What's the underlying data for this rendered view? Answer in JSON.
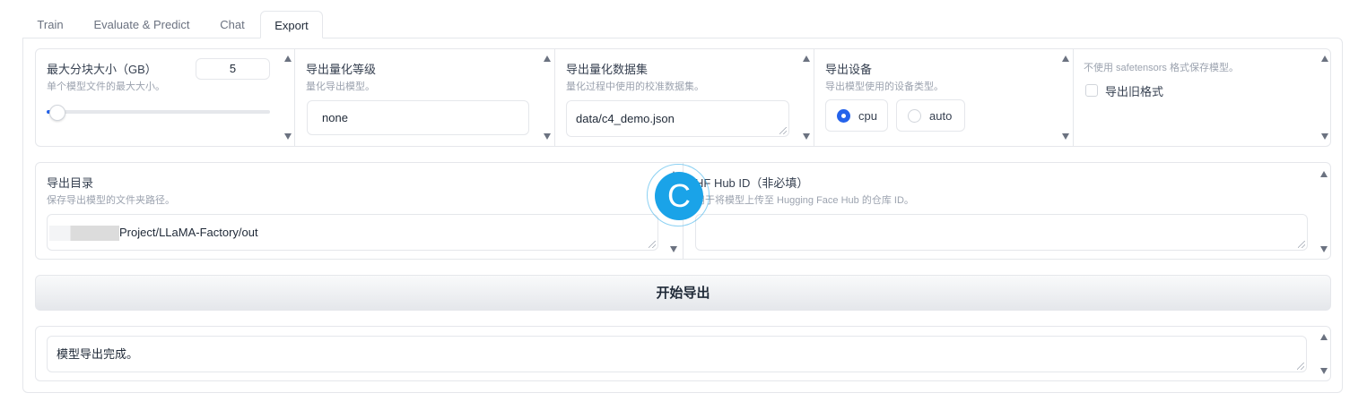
{
  "tabs": [
    {
      "label": "Train"
    },
    {
      "label": "Evaluate & Predict"
    },
    {
      "label": "Chat"
    },
    {
      "label": "Export"
    }
  ],
  "shard_size": {
    "label": "最大分块大小（GB）",
    "info": "单个模型文件的最大大小。",
    "value": "5",
    "slider_fraction": 0.05
  },
  "quant_bit": {
    "label": "导出量化等级",
    "info": "量化导出模型。",
    "value": "none"
  },
  "quant_dataset": {
    "label": "导出量化数据集",
    "info": "量化过程中使用的校准数据集。",
    "value": "data/c4_demo.json"
  },
  "device": {
    "label": "导出设备",
    "info": "导出模型使用的设备类型。",
    "options": [
      "cpu",
      "auto"
    ],
    "selected": "cpu"
  },
  "legacy": {
    "info": "不使用 safetensors 格式保存模型。",
    "label": "导出旧格式",
    "checked": false
  },
  "export_dir": {
    "label": "导出目录",
    "info": "保存导出模型的文件夹路径。",
    "value": "Project/LLaMA-Factory/out"
  },
  "hub_id": {
    "label": "HF Hub ID（非必填）",
    "info": "用于将模型上传至 Hugging Face Hub 的仓库 ID。",
    "value": ""
  },
  "export_button": {
    "label": "开始导出"
  },
  "output": {
    "value": "模型导出完成。"
  },
  "overlay_icon": {
    "letter": "C",
    "color": "#1aa3e8"
  },
  "colors": {
    "accent": "#2563eb",
    "slider_track": "#e5e7eb",
    "border": "#e5e7eb"
  }
}
